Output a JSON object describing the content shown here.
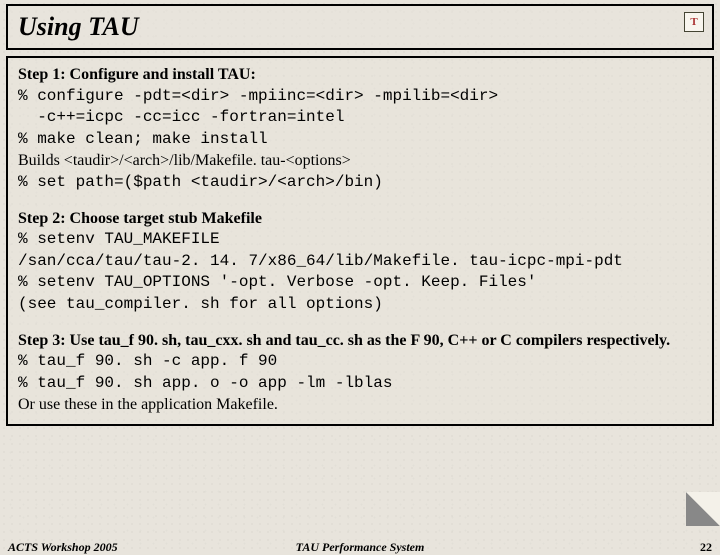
{
  "title": "Using TAU",
  "logo_letter": "T",
  "steps": [
    {
      "label": "Step 1: Configure and install TAU:",
      "lines": [
        {
          "t": "mono",
          "v": "% configure -pdt=<dir> -mpiinc=<dir> -mpilib=<dir>"
        },
        {
          "t": "mono",
          "v": "  -c++=icpc -cc=icc -fortran=intel"
        },
        {
          "t": "mono",
          "v": "% make clean; make install"
        },
        {
          "t": "plain",
          "v": "Builds <taudir>/<arch>/lib/Makefile. tau-<options>"
        },
        {
          "t": "mono",
          "v": "% set path=($path <taudir>/<arch>/bin)"
        }
      ]
    },
    {
      "label": "Step 2: Choose target stub Makefile",
      "lines": [
        {
          "t": "mono",
          "v": "% setenv TAU_MAKEFILE"
        },
        {
          "t": "mono",
          "v": "/san/cca/tau/tau-2. 14. 7/x86_64/lib/Makefile. tau-icpc-mpi-pdt"
        },
        {
          "t": "mono",
          "v": "% setenv TAU_OPTIONS '-opt. Verbose -opt. Keep. Files'"
        },
        {
          "t": "mono",
          "v": "(see tau_compiler. sh for all options)"
        }
      ]
    },
    {
      "label": "Step 3: Use tau_f 90. sh, tau_cxx. sh and tau_cc. sh as the F 90, C++ or C compilers respectively.",
      "lines": [
        {
          "t": "mono",
          "v": "% tau_f 90. sh -c app. f 90"
        },
        {
          "t": "mono",
          "v": "% tau_f 90. sh app. o -o app -lm -lblas"
        },
        {
          "t": "plain",
          "v": "Or use these in the application Makefile."
        }
      ]
    }
  ],
  "footer": {
    "left": "ACTS Workshop 2005",
    "center": "TAU Performance System",
    "right": "22"
  }
}
